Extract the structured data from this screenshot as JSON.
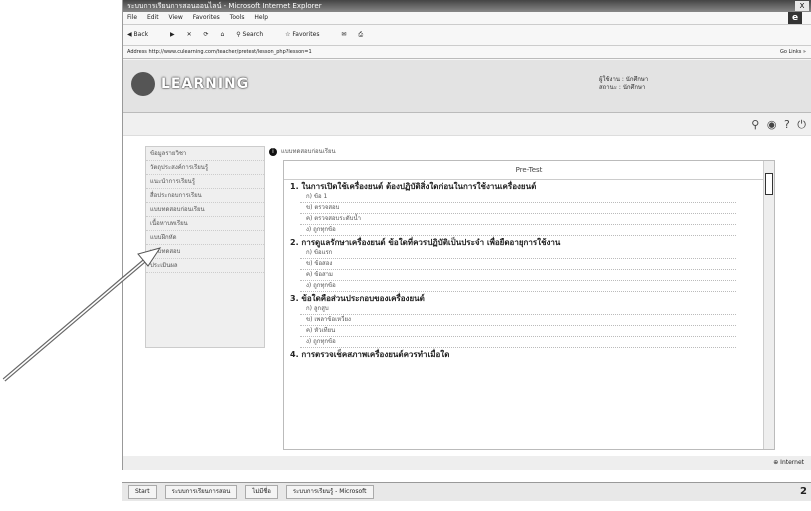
{
  "window": {
    "title": "ระบบการเรียนการสอนออนไลน์ - Microsoft Internet Explorer",
    "close_label": "X"
  },
  "menubar": [
    "File",
    "Edit",
    "View",
    "Favorites",
    "Tools",
    "Help"
  ],
  "toolbar": {
    "back": "Back",
    "search": "Search",
    "favorites": "Favorites"
  },
  "address": {
    "label": "Address",
    "url": "http://www.culearning.com/teacher/pretest/lesson_php?lesson=1",
    "go": "Go",
    "links": "Links »"
  },
  "site": {
    "logo": "LEARNING",
    "user_name": "ผู้ใช้งาน : นักศึกษา",
    "user_status": "สถานะ : นักศึกษา"
  },
  "sidebar": {
    "items": [
      "ข้อมูลรายวิชา",
      "วัตถุประสงค์การเรียนรู้",
      "แนะนำการเรียนรู้",
      "สื่อประกอบการเรียน",
      "แบบทดสอบก่อนเรียน",
      "เนื้อหาบทเรียน",
      "แบบฝึกหัด",
      "แบบทดสอบ",
      "ประเมินผล"
    ]
  },
  "content": {
    "crumb": "แบบทดสอบก่อนเรียน",
    "test_title": "Pre-Test",
    "questions": [
      {
        "text": "1. ในการเปิดใช้เครื่องยนต์ ต้องปฏิบัติสิ่งใดก่อนในการใช้งานเครื่องยนต์",
        "options": [
          "ก) ข้อ 1",
          "ข) ตรวจสอบ",
          "ค) ตรวจสอบระดับน้ำ",
          "ง) ถูกทุกข้อ"
        ]
      },
      {
        "text": "2. การดูแลรักษาเครื่องยนต์ ข้อใดที่ควรปฏิบัติเป็นประจำ เพื่อยืดอายุการใช้งาน",
        "options": [
          "ก) ข้อแรก",
          "ข) ข้อสอง",
          "ค) ข้อสาม",
          "ง) ถูกทุกข้อ"
        ]
      },
      {
        "text": "3. ข้อใดคือส่วนประกอบของเครื่องยนต์",
        "options": [
          "ก) ลูกสูบ",
          "ข) เพลาข้อเหวี่ยง",
          "ค) หัวเทียน",
          "ง) ถูกทุกข้อ"
        ]
      },
      {
        "text": "4. การตรวจเช็คสภาพเครื่องยนต์ควรทำเมื่อใด",
        "options": []
      }
    ]
  },
  "statusbar": {
    "left": "",
    "zone": "Internet"
  },
  "taskbar": {
    "start": "Start",
    "items": [
      "ระบบการเรียนการสอน",
      "ไม่มีชื่อ",
      "ระบบการเรียนรู้ - Microsoft"
    ],
    "clock": "2"
  }
}
